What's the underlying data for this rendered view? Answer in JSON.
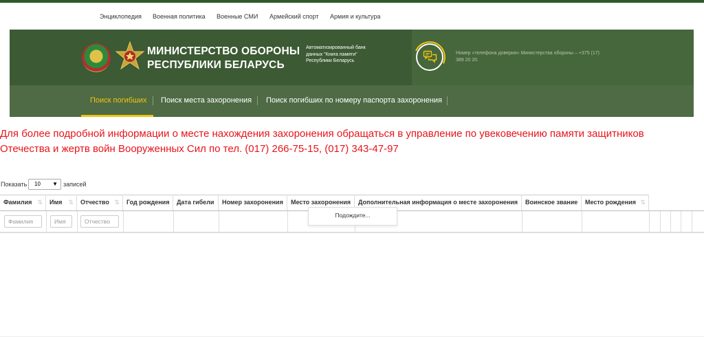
{
  "top_nav": [
    "Энциклопедия",
    "Военная политика",
    "Военные СМИ",
    "Армейский спорт",
    "Армия и культура"
  ],
  "header": {
    "ministry_line1": "МИНИСТЕРСТВО ОБОРОНЫ",
    "ministry_line2": "РЕСПУБЛИКИ БЕЛАРУСЬ",
    "description": "Автоматизированный банк данных \"Книга памяти\" Республики Беларусь",
    "trust_phone": "Номер «телефона доверия» Министерства обороны – +375 (17) 389 20 20."
  },
  "menu": [
    "Поиск погибших",
    "Поиск места захоронения",
    "Поиск погибших по номеру паспорта захоронения"
  ],
  "notice": "Для более подробной информации о месте нахождения захоронения обращаться в управление по увековечению памяти защитников Отечества и жертв войн Вооруженных Сил по тел. (017) 266-75-15, (017) 343-47-97",
  "table_controls": {
    "show_label": "Показать",
    "page_length": "10",
    "records_label": "записей"
  },
  "columns": [
    "Фамилия",
    "Имя",
    "Отчество",
    "Год рождения",
    "Дата гибели",
    "Номер захоронения",
    "Место захоронения",
    "Дополнительная информация о месте захоронения",
    "Воинское звание",
    "Место рождения"
  ],
  "filters": {
    "surname_placeholder": "Фамилия",
    "name_placeholder": "Имя",
    "patronymic_placeholder": "Отчество"
  },
  "processing_text": "Подождите...",
  "colors": {
    "banner": "#3c5a33",
    "menu": "#4f6b45",
    "accent": "#f1c40f",
    "notice": "#e8141a"
  }
}
